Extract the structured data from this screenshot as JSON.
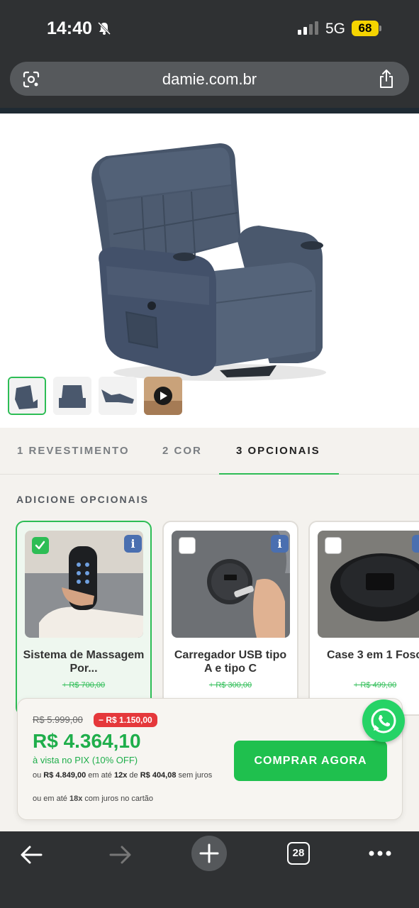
{
  "status_bar": {
    "time": "14:40",
    "network": "5G",
    "battery": "68"
  },
  "browser": {
    "url": "damie.com.br",
    "tab_count": "28"
  },
  "gallery": {
    "thumbnails": [
      "chair-angled",
      "chair-front",
      "chair-reclined",
      "video"
    ]
  },
  "steps": [
    {
      "label": "1 REVESTIMENTO"
    },
    {
      "label": "2 COR"
    },
    {
      "label": "3 OPCIONAIS"
    }
  ],
  "options_section": {
    "title": "ADICIONE OPCIONAIS",
    "cards": [
      {
        "name": "Sistema de Massagem Por...",
        "old_price": "+ R$ 700,00",
        "selected": true
      },
      {
        "name": "Carregador USB tipo A e tipo C",
        "old_price": "+ R$ 300,00",
        "selected": false
      },
      {
        "name": "Case 3 em 1 Fosc",
        "old_price": "+ R$ 499,00",
        "selected": false
      }
    ]
  },
  "purchase": {
    "old_price": "R$ 5.999,00",
    "discount": "− R$ 1.150,00",
    "price": "R$ 4.364,10",
    "pix_note": "à vista no PIX (10% OFF)",
    "installment_prefix": "ou ",
    "installment_total": "R$ 4.849,00",
    "installment_mid": " em até ",
    "installment_count": "12x",
    "installment_of": " de ",
    "installment_value": "R$ 404,08",
    "installment_suffix": " sem juros",
    "credit_prefix": "ou em até ",
    "credit_count": "18x",
    "credit_suffix": " com juros no cartão",
    "buy_button": "COMPRAR AGORA"
  },
  "colors": {
    "accent": "#2dbd55",
    "price": "#1fae4b",
    "discount": "#e5383b",
    "browser_chrome": "#2f3133"
  }
}
